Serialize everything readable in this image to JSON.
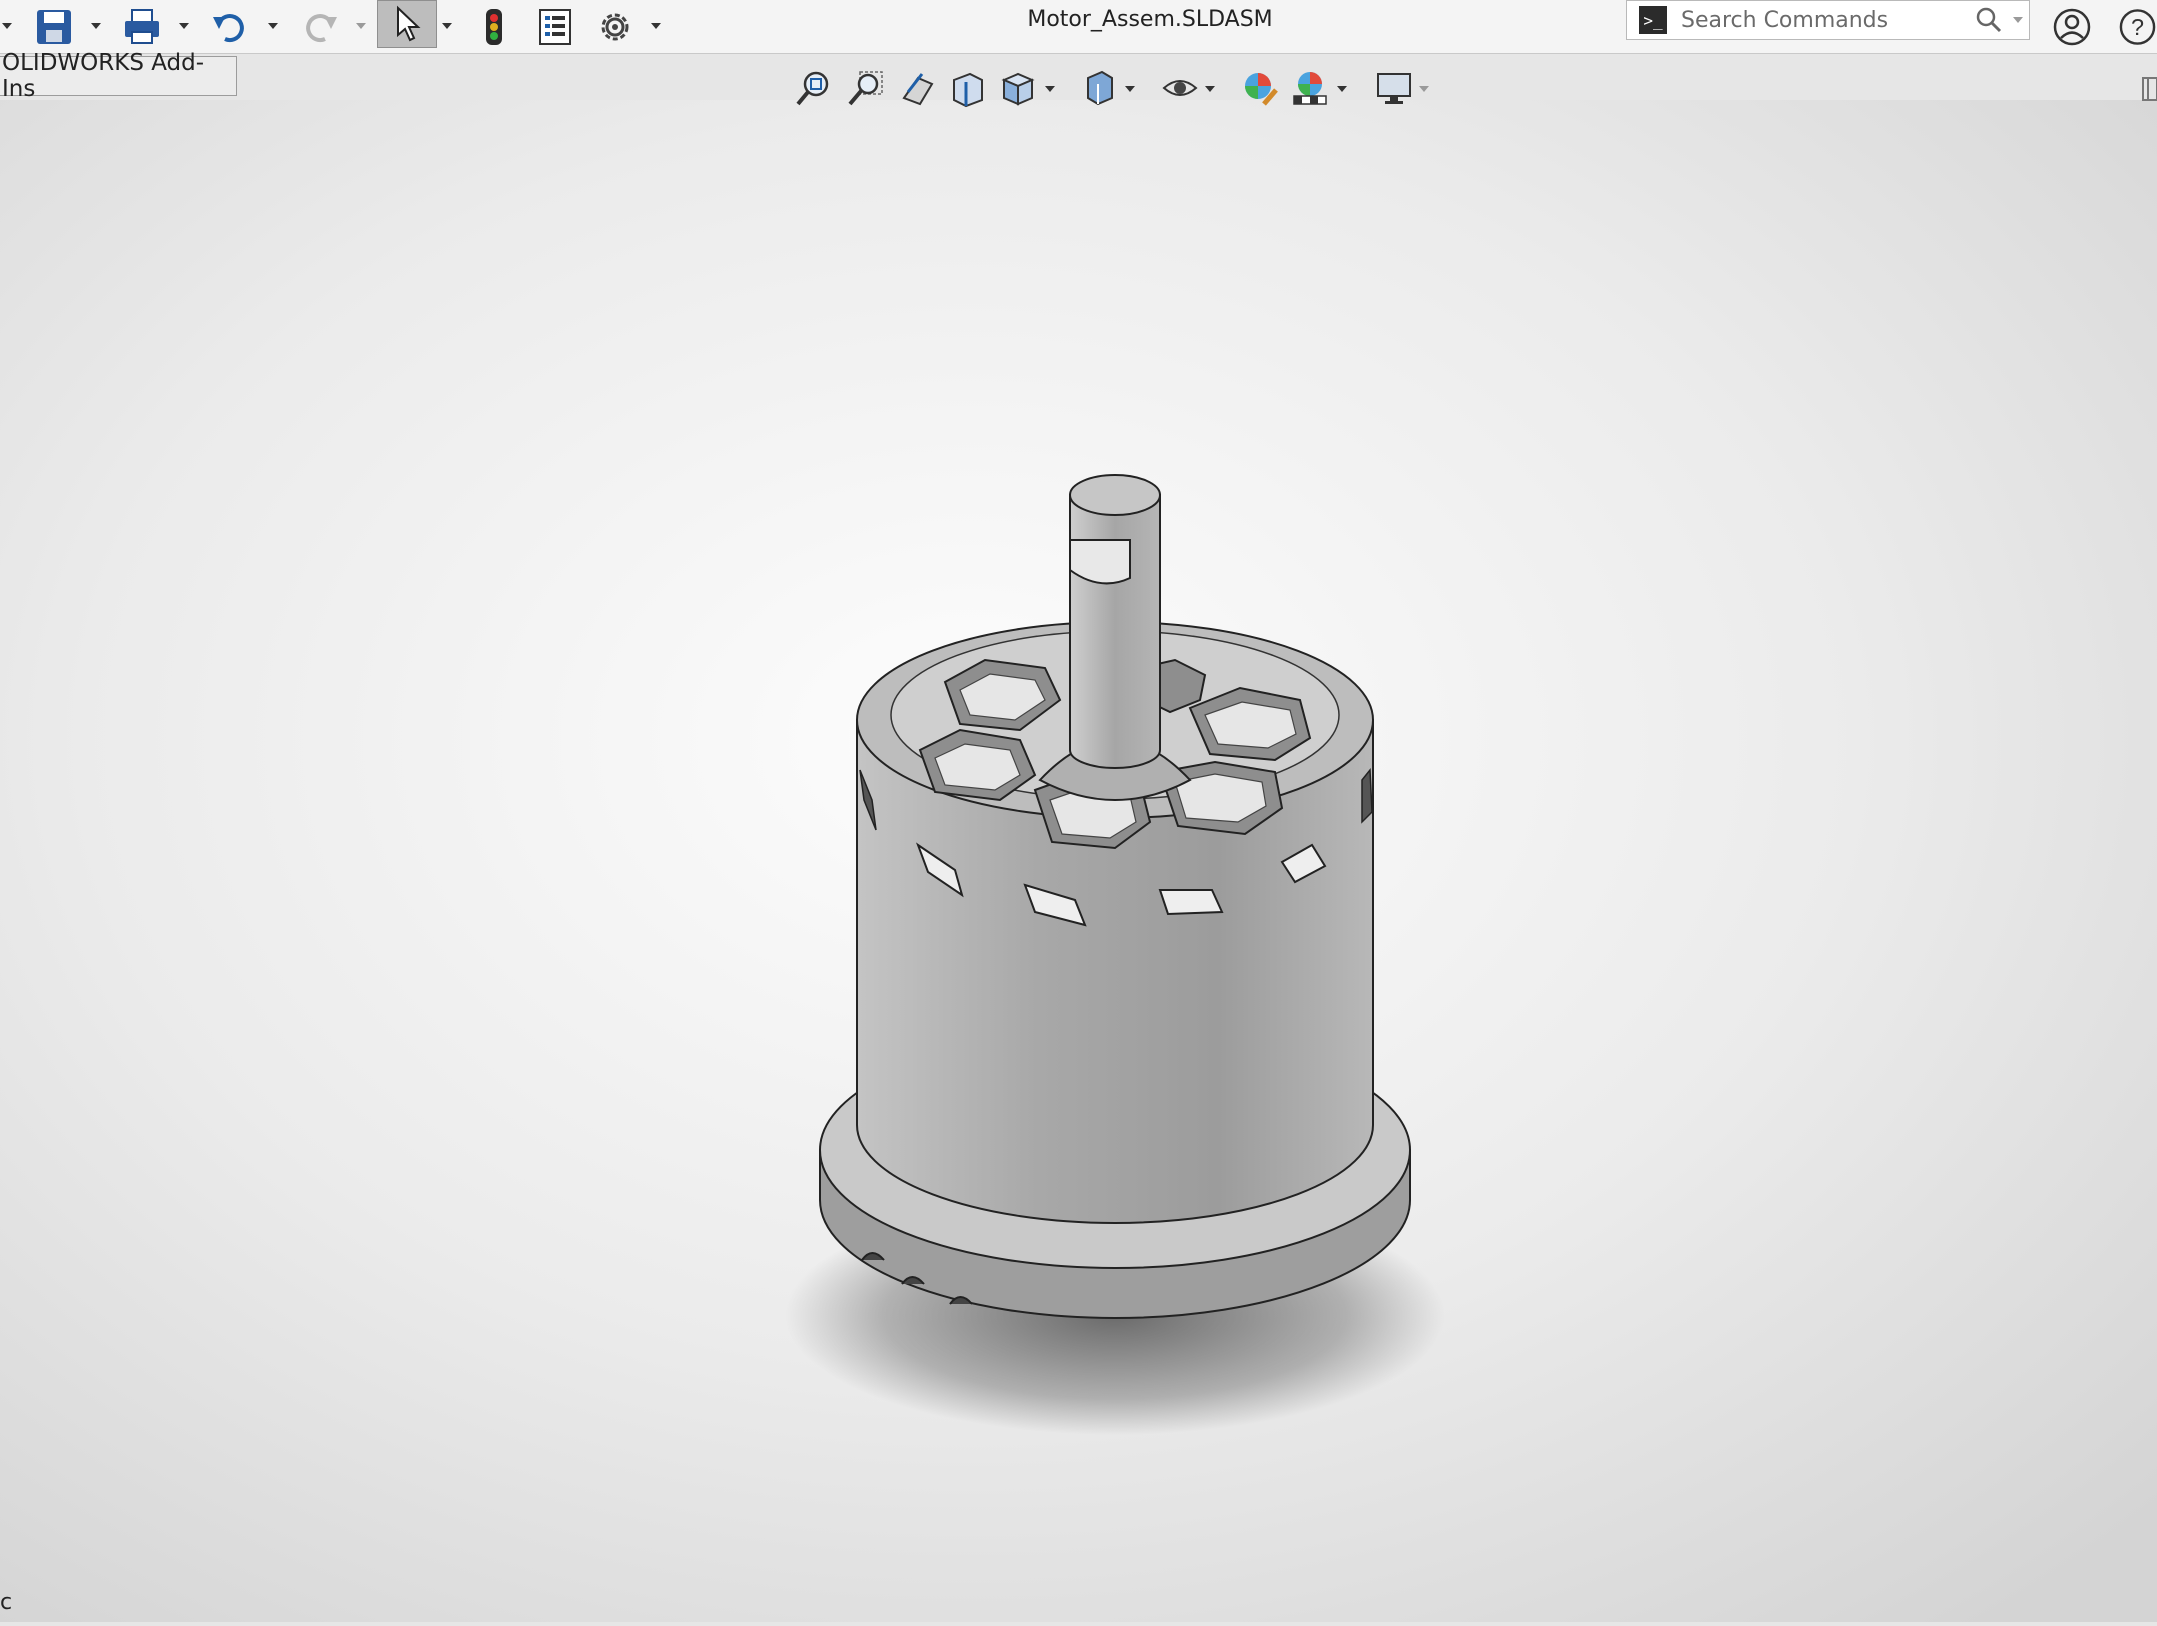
{
  "titlebar": {
    "document_title": "Motor_Assem.SLDASM",
    "tools": [
      {
        "name": "save-icon"
      },
      {
        "name": "print-icon"
      },
      {
        "name": "undo-icon"
      },
      {
        "name": "redo-icon"
      },
      {
        "name": "select-arrow-icon"
      },
      {
        "name": "rebuild-traffic-light-icon"
      },
      {
        "name": "file-properties-icon"
      },
      {
        "name": "options-gear-icon"
      }
    ],
    "search": {
      "placeholder": "Search Commands",
      "prompt_glyph": ">_"
    },
    "user_icon": "user-account-icon",
    "help_icon": "help-icon",
    "help_glyph": "?"
  },
  "command_manager": {
    "addins_tab_label": "OLIDWORKS Add-Ins"
  },
  "view_toolbar": {
    "items": [
      "zoom-to-fit-icon",
      "zoom-to-area-icon",
      "previous-view-icon",
      "section-view-icon",
      "view-orientation-icon",
      "display-style-icon",
      "hide-show-items-icon",
      "edit-appearance-icon",
      "apply-scene-icon",
      "view-settings-icon"
    ]
  },
  "status_bar": {
    "text": "c"
  },
  "colors": {
    "background": "#e6e6e6",
    "toolbar": "#f4f4f4",
    "model_gray": "#a9a9a9",
    "accent_blue": "#1f5fa8"
  }
}
